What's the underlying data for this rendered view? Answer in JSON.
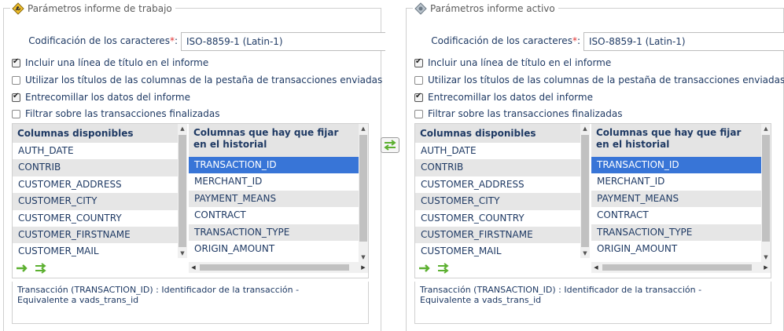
{
  "left_panel": {
    "title": "Parámetros informe de trabajo",
    "icon": "settings-wrench-icon",
    "encoding_label": "Codificación de los caracteres",
    "required_mark": "*",
    "encoding_value": "ISO-8859-1 (Latin-1)",
    "options": [
      {
        "label": "Incluir una línea de título en el informe",
        "checked": true
      },
      {
        "label": "Utilizar los títulos de las columnas de la pestaña de transacciones enviadas",
        "checked": false
      },
      {
        "label": "Entrecomillar los datos del informe",
        "checked": true
      },
      {
        "label": "Filtrar sobre las transacciones finalizadas",
        "checked": false
      }
    ],
    "available_header": "Columnas disponibles",
    "available": [
      "AUTH_DATE",
      "CONTRIB",
      "CUSTOMER_ADDRESS",
      "CUSTOMER_CITY",
      "CUSTOMER_COUNTRY",
      "CUSTOMER_FIRSTNAME",
      "CUSTOMER_MAIL"
    ],
    "fixed_header": "Columnas que hay que fijar en el historial",
    "fixed": [
      "TRANSACTION_ID",
      "MERCHANT_ID",
      "PAYMENT_MEANS",
      "CONTRACT",
      "TRANSACTION_TYPE",
      "ORIGIN_AMOUNT"
    ],
    "selected_fixed": "TRANSACTION_ID",
    "description_line1": "Transacción (TRANSACTION_ID) : Identificador de la transacción -",
    "description_line2": "Equivalente a vads_trans_id"
  },
  "right_panel": {
    "title": "Parámetros informe activo",
    "icon": "settings-gear-icon",
    "encoding_label": "Codificación de los caracteres",
    "required_mark": "*",
    "encoding_value": "ISO-8859-1 (Latin-1)",
    "options": [
      {
        "label": "Incluir una línea de título en el informe",
        "checked": true
      },
      {
        "label": "Utilizar los títulos de las columnas de la pestaña de transacciones enviadas",
        "checked": false
      },
      {
        "label": "Entrecomillar los datos del informe",
        "checked": true
      },
      {
        "label": "Filtrar sobre las transacciones finalizadas",
        "checked": false
      }
    ],
    "available_header": "Columnas disponibles",
    "available": [
      "AUTH_DATE",
      "CONTRIB",
      "CUSTOMER_ADDRESS",
      "CUSTOMER_CITY",
      "CUSTOMER_COUNTRY",
      "CUSTOMER_FIRSTNAME",
      "CUSTOMER_MAIL"
    ],
    "fixed_header": "Columnas que hay que fijar en el historial",
    "fixed": [
      "TRANSACTION_ID",
      "MERCHANT_ID",
      "PAYMENT_MEANS",
      "CONTRACT",
      "TRANSACTION_TYPE",
      "ORIGIN_AMOUNT"
    ],
    "selected_fixed": "TRANSACTION_ID",
    "description_line1": "Transacción (TRANSACTION_ID) : Identificador de la transacción -",
    "description_line2": "Equivalente a vads_trans_id"
  },
  "colors": {
    "selection": "#3875d7",
    "text": "#1f3a64",
    "required": "#e03030",
    "arrow_green": "#5cb030"
  }
}
